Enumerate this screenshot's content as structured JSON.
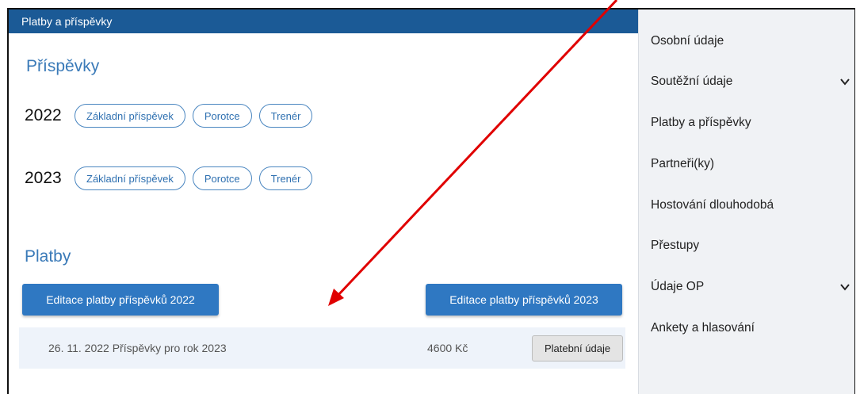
{
  "main": {
    "header": "Platby a příspěvky",
    "contributions_title": "Příspěvky",
    "years": [
      {
        "year": "2022",
        "pills": [
          "Základní příspěvek",
          "Porotce",
          "Trenér"
        ]
      },
      {
        "year": "2023",
        "pills": [
          "Základní příspěvek",
          "Porotce",
          "Trenér"
        ]
      }
    ],
    "payments_title": "Platby",
    "edit_2022": "Editace platby příspěvků 2022",
    "edit_2023": "Editace platby příspěvků 2023",
    "payment": {
      "date_desc": "26. 11. 2022  Příspěvky pro rok 2023",
      "amount": "4600 Kč",
      "details_button": "Platební údaje"
    }
  },
  "sidebar": {
    "items": [
      {
        "label": "Osobní údaje",
        "has_chevron": false
      },
      {
        "label": "Soutěžní údaje",
        "has_chevron": true
      },
      {
        "label": "Platby a příspěvky",
        "has_chevron": false
      },
      {
        "label": "Partneři(ky)",
        "has_chevron": false
      },
      {
        "label": "Hostování dlouhodobá",
        "has_chevron": false
      },
      {
        "label": "Přestupy",
        "has_chevron": false
      },
      {
        "label": "Údaje OP",
        "has_chevron": true
      },
      {
        "label": "Ankety a hlasování",
        "has_chevron": false
      }
    ]
  },
  "colors": {
    "header_bg": "#1b5a96",
    "accent_blue": "#2f78c2",
    "annotation_arrow": "#e00000"
  }
}
